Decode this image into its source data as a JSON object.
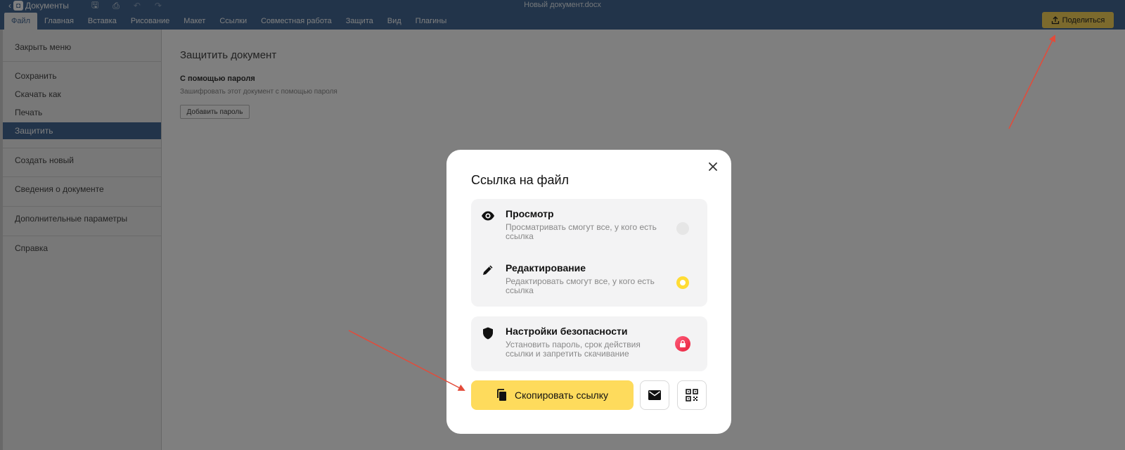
{
  "app": {
    "brand": "Документы",
    "document_title": "Новый документ.docx",
    "share_label": "Поделиться"
  },
  "tabs": [
    "Файл",
    "Главная",
    "Вставка",
    "Рисование",
    "Макет",
    "Ссылки",
    "Совместная работа",
    "Защита",
    "Вид",
    "Плагины"
  ],
  "file_menu": {
    "close": "Закрыть меню",
    "save": "Сохранить",
    "download_as": "Скачать как",
    "print": "Печать",
    "protect": "Защитить",
    "create_new": "Создать новый",
    "doc_info": "Сведения о документе",
    "advanced": "Дополнительные параметры",
    "help": "Справка"
  },
  "protect_panel": {
    "title": "Защитить документ",
    "section": "С помощью пароля",
    "description": "Зашифровать этот документ с помощью пароля",
    "add_password": "Добавить пароль"
  },
  "share_dialog": {
    "title": "Ссылка на файл",
    "options": [
      {
        "label": "Просмотр",
        "description": "Просматривать смогут все, у кого есть ссылка",
        "selected": false
      },
      {
        "label": "Редактирование",
        "description": "Редактировать смогут все, у кого есть ссылка",
        "selected": true
      }
    ],
    "security": {
      "label": "Настройки безопасности",
      "description": "Установить пароль, срок действия ссылки и запретить скачивание"
    },
    "copy_link": "Скопировать ссылку"
  },
  "colors": {
    "header": "#446995",
    "share_button": "#f8d55a",
    "copy_button": "#fedb5c",
    "selected_radio": "#ffdc34",
    "annotation_arrow": "#e34b3a"
  }
}
